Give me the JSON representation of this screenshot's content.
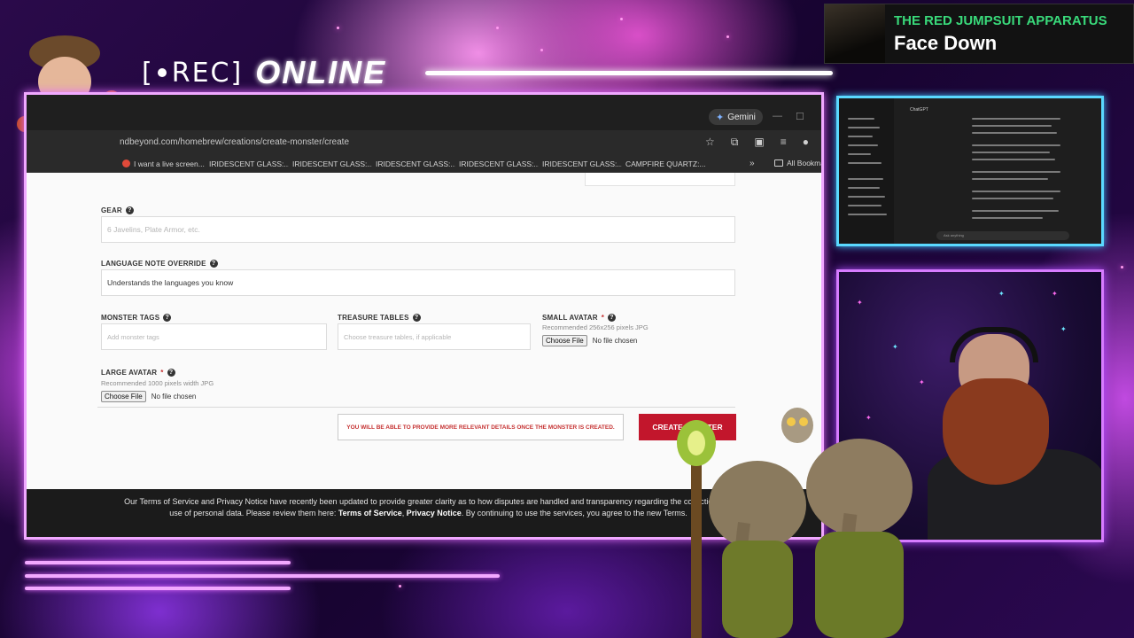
{
  "overlay": {
    "rec_label": "REC",
    "online_label": "ONLINE"
  },
  "now_playing": {
    "artist": "THE RED JUMPSUIT APPARATUS",
    "song": "Face Down"
  },
  "browser": {
    "gemini_label": "Gemini",
    "url": "ndbeyond.com/homebrew/creations/create-monster/create",
    "bookmarks": [
      {
        "label": "I want a live screen...",
        "icon": "reddit-icon"
      },
      {
        "label": "IRIDESCENT GLASS:...",
        "icon": "globe-icon"
      },
      {
        "label": "IRIDESCENT GLASS:...",
        "icon": "image-icon"
      },
      {
        "label": "IRIDESCENT GLASS:...",
        "icon": "image-icon"
      },
      {
        "label": "IRIDESCENT GLASS:...",
        "icon": "image-icon"
      },
      {
        "label": "IRIDESCENT GLASS:...",
        "icon": "image-icon"
      },
      {
        "label": "CAMPFIRE QUARTZ:...",
        "icon": "image-icon"
      }
    ],
    "bookmarks_folder": "All Bookma"
  },
  "form": {
    "gear": {
      "label": "GEAR",
      "placeholder": "6 Javelins, Plate Armor, etc."
    },
    "language_note": {
      "label": "LANGUAGE NOTE OVERRIDE",
      "value": "Understands the languages you know"
    },
    "monster_tags": {
      "label": "MONSTER TAGS",
      "placeholder": "Add monster tags"
    },
    "treasure_tables": {
      "label": "TREASURE TABLES",
      "placeholder": "Choose treasure tables, if applicable"
    },
    "small_avatar": {
      "label": "SMALL AVATAR",
      "required": "*",
      "hint": "Recommended 256x256 pixels JPG",
      "button": "Choose File",
      "status": "No file chosen"
    },
    "large_avatar": {
      "label": "LARGE AVATAR",
      "required": "*",
      "hint": "Recommended 1000 pixels width JPG",
      "button": "Choose File",
      "status": "No file chosen"
    },
    "notice": "YOU WILL BE ABLE TO PROVIDE MORE RELEVANT DETAILS ONCE THE MONSTER IS CREATED.",
    "create_button": "CREATE MONSTER"
  },
  "cookie_bar": {
    "text_before": "Our Terms of Service and Privacy Notice have recently been updated to provide greater clarity as to how disputes are handled and transparency regarding the collection and use of personal data. Please review them here: ",
    "terms_link": "Terms of Service",
    "separator": ", ",
    "privacy_link": "Privacy Notice",
    "text_after": ". By continuing to use the services, you agree to the new Terms."
  },
  "side_screen": {
    "title": "ChatGPT",
    "input_placeholder": "Ask anything"
  },
  "colors": {
    "accent_red": "#c2162c",
    "artist_green": "#39d97a",
    "frame_pink": "#f0a8ff",
    "frame_cyan": "#5ad9ff"
  }
}
